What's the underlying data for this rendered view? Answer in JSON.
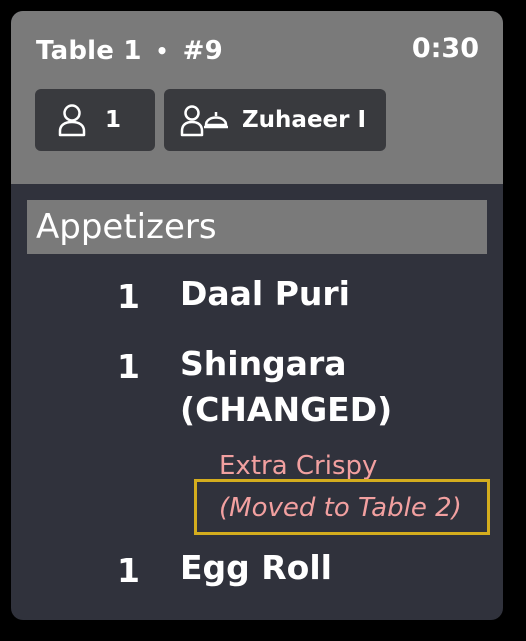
{
  "ticket": {
    "table": "Table 1",
    "separator": "•",
    "number": "#9",
    "timer": "0:30",
    "guests": "1",
    "server": "Zuhaeer I"
  },
  "section": "Appetizers",
  "items": [
    {
      "qty": "1",
      "name": "Daal Puri"
    },
    {
      "qty": "1",
      "name_line1": "Shingara",
      "name_line2": "(CHANGED)",
      "modifiers": [
        "Extra Crispy",
        "(Moved to Table 2)"
      ]
    },
    {
      "qty": "1",
      "name": "Egg Roll"
    }
  ],
  "icons": {
    "guests": "person-icon",
    "server": "server-bell-icon"
  },
  "colors": {
    "header": "#7a7a7a",
    "card": "#30323c",
    "modifier": "#f2a0a0",
    "highlight": "#d4ad1e"
  }
}
